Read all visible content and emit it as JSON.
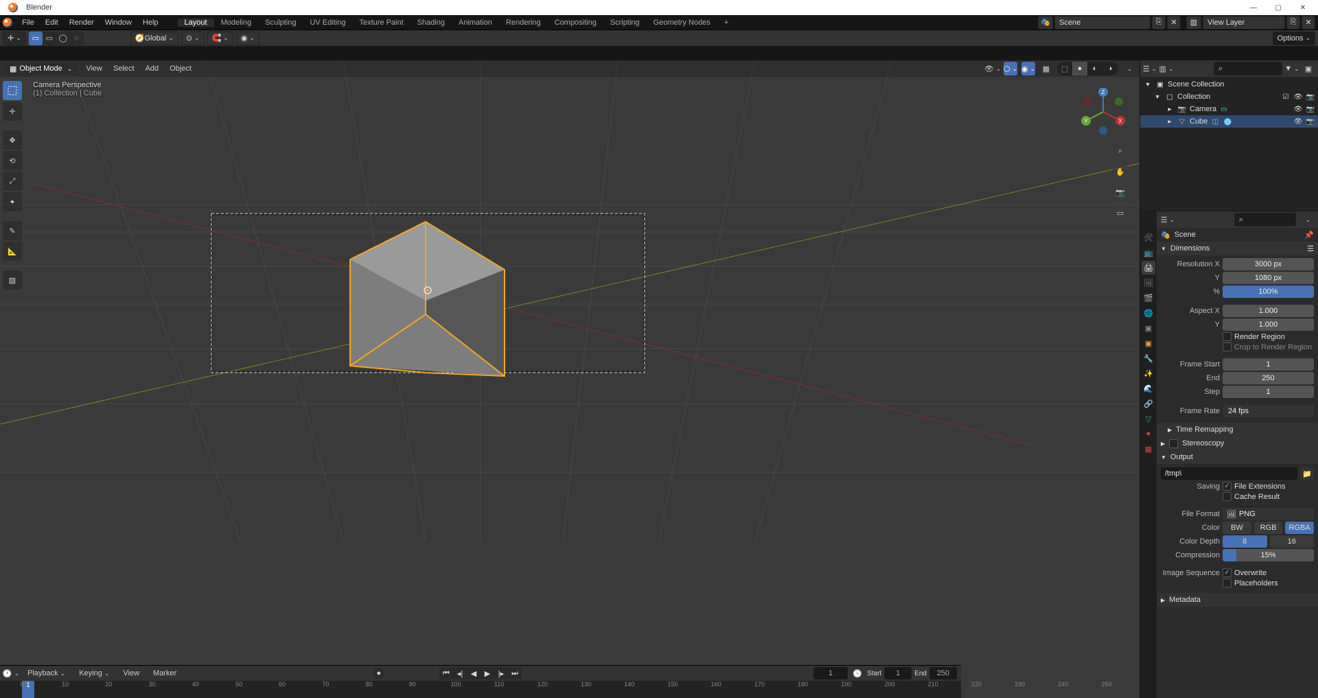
{
  "window": {
    "title": "Blender"
  },
  "menus": [
    "File",
    "Edit",
    "Render",
    "Window",
    "Help"
  ],
  "workspaces": [
    "Layout",
    "Modeling",
    "Sculpting",
    "UV Editing",
    "Texture Paint",
    "Shading",
    "Animation",
    "Rendering",
    "Compositing",
    "Scripting",
    "Geometry Nodes"
  ],
  "scene_field": "Scene",
  "viewlayer_field": "View Layer",
  "viewport": {
    "mode": "Object Mode",
    "menus": [
      "View",
      "Select",
      "Add",
      "Object"
    ],
    "orientation": "Global",
    "overlay_title": "Camera Perspective",
    "overlay_sub": "(1) Collection | Cube",
    "options": "Options"
  },
  "outliner": {
    "root": "Scene Collection",
    "collection": "Collection",
    "items": [
      "Camera",
      "Cube"
    ]
  },
  "props": {
    "context": "Scene",
    "dimensions": {
      "title": "Dimensions",
      "res_x_lbl": "Resolution X",
      "res_x": "3000 px",
      "res_y_lbl": "Y",
      "res_y": "1080 px",
      "pct_lbl": "%",
      "pct": "100%",
      "aspect_x_lbl": "Aspect X",
      "aspect_x": "1.000",
      "aspect_y_lbl": "Y",
      "aspect_y": "1.000",
      "render_region": "Render Region",
      "crop": "Crop to Render Region",
      "fstart_lbl": "Frame Start",
      "fstart": "1",
      "fend_lbl": "End",
      "fend": "250",
      "fstep_lbl": "Step",
      "fstep": "1",
      "frate_lbl": "Frame Rate",
      "frate": "24 fps"
    },
    "time_remap": "Time Remapping",
    "stereo": "Stereoscopy",
    "output": {
      "title": "Output",
      "path": "/tmp\\",
      "saving_lbl": "Saving",
      "file_ext": "File Extensions",
      "cache": "Cache Result",
      "fmt_lbl": "File Format",
      "fmt": "PNG",
      "color_lbl": "Color",
      "bw": "BW",
      "rgb": "RGB",
      "rgba": "RGBA",
      "depth_lbl": "Color Depth",
      "d8": "8",
      "d16": "16",
      "comp_lbl": "Compression",
      "comp": "15%",
      "seq_lbl": "Image Sequence",
      "overwrite": "Overwrite",
      "placeholders": "Placeholders"
    },
    "metadata": "Metadata"
  },
  "timeline": {
    "playback": "Playback",
    "keying": "Keying",
    "view": "View",
    "marker": "Marker",
    "cur": "1",
    "start_lbl": "Start",
    "start": "1",
    "end_lbl": "End",
    "end": "250",
    "ticks": [
      0,
      10,
      20,
      30,
      40,
      50,
      60,
      70,
      80,
      90,
      100,
      110,
      120,
      130,
      140,
      150,
      160,
      170,
      180,
      190,
      200,
      210,
      220,
      230,
      240,
      250
    ]
  }
}
